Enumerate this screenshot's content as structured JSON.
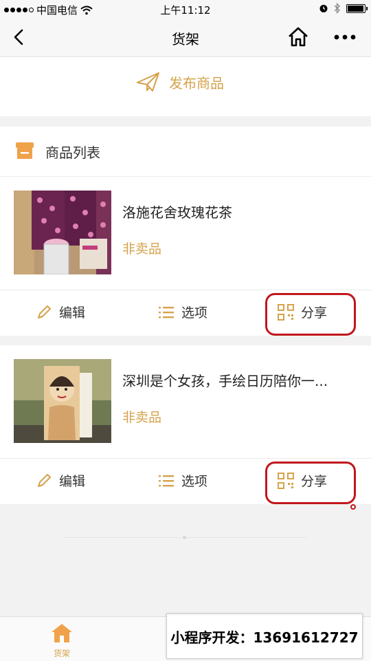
{
  "status_bar": {
    "carrier": "中国电信",
    "time": "上午11:12",
    "battery_level": 0.9
  },
  "nav": {
    "title": "货架"
  },
  "publish": {
    "label": "发布商品",
    "color": "#d6a24b"
  },
  "list": {
    "title": "商品列表",
    "products": [
      {
        "name": "洛施花舍玫瑰花茶",
        "status": "非卖品",
        "actions": {
          "edit": "编辑",
          "options": "选项",
          "share": "分享"
        }
      },
      {
        "name": "深圳是个女孩，手绘日历陪你一...",
        "status": "非卖品",
        "actions": {
          "edit": "编辑",
          "options": "选项",
          "share": "分享"
        }
      }
    ]
  },
  "tabbar": {
    "home_label": "货架"
  },
  "overlay": {
    "contact_text": "小程序开发：13691612727"
  },
  "colors": {
    "accent": "#d6a24b",
    "highlight": "#c0161c"
  }
}
